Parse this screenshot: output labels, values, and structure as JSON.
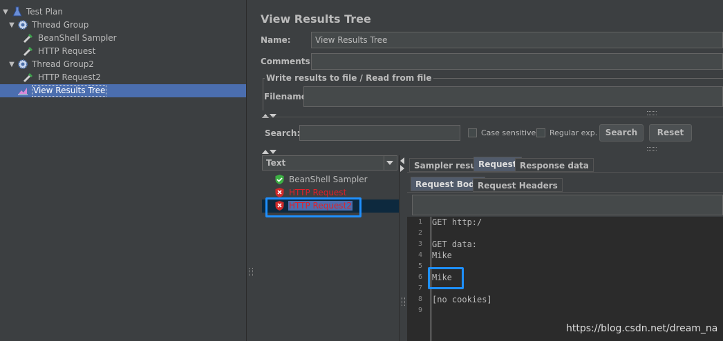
{
  "tree": {
    "items": [
      {
        "label": "Test Plan",
        "icon": "flask-icon"
      },
      {
        "label": "Thread Group",
        "icon": "gear-icon"
      },
      {
        "label": "BeanShell Sampler",
        "icon": "pipette-icon"
      },
      {
        "label": "HTTP Request",
        "icon": "pipette-icon"
      },
      {
        "label": "Thread Group2",
        "icon": "gear-icon"
      },
      {
        "label": "HTTP Request2",
        "icon": "pipette-icon"
      },
      {
        "label": "View Results Tree",
        "icon": "chart-icon"
      }
    ]
  },
  "panel": {
    "title": "View Results Tree",
    "name_label": "Name:",
    "name_value": "View Results Tree",
    "comments_label": "Comments:",
    "comments_value": "",
    "file_section_title": "Write results to file / Read from file",
    "filename_label": "Filename",
    "filename_value": ""
  },
  "search": {
    "label": "Search:",
    "value": "",
    "case_sensitive_label": "Case sensitive",
    "regex_label": "Regular exp.",
    "search_button": "Search",
    "reset_button": "Reset"
  },
  "results": {
    "renderer": "Text",
    "samples": [
      {
        "label": "BeanShell Sampler",
        "status": "success"
      },
      {
        "label": "HTTP Request",
        "status": "error"
      },
      {
        "label": "HTTP Request2",
        "status": "error"
      }
    ]
  },
  "detail": {
    "tabs": [
      "Sampler result",
      "Request",
      "Response data"
    ],
    "sub_tabs": [
      "Request Body",
      "Request Headers"
    ],
    "lines": [
      "GET http:/",
      "",
      "GET data:",
      "Mike",
      "",
      "Mike",
      "",
      "[no cookies]",
      ""
    ],
    "line_numbers": [
      "1",
      "2",
      "3",
      "4",
      "5",
      "6",
      "7",
      "8",
      "9"
    ]
  },
  "watermark": "https://blog.csdn.net/dream_na",
  "colors": {
    "selection": "#4b6eaf",
    "error_text": "#e0202a",
    "success_icon": "#3cb043",
    "highlight": "#1e90ff"
  }
}
